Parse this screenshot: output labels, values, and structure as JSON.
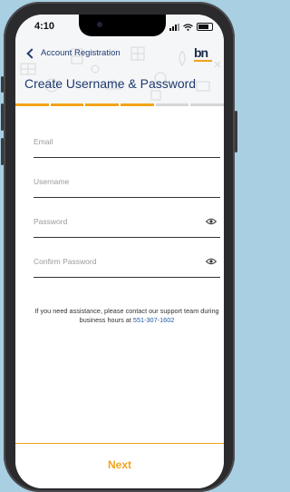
{
  "status_bar": {
    "time": "4:10"
  },
  "header": {
    "back_label": "Account Registration",
    "logo_text": "bn",
    "title": "Create Username & Password"
  },
  "progress": {
    "total_steps": 6,
    "completed_steps": 4,
    "active_color": "#f2a31b",
    "inactive_color": "#d6d6d6"
  },
  "form": {
    "email": {
      "placeholder": "Email",
      "value": ""
    },
    "username": {
      "placeholder": "Username",
      "value": ""
    },
    "password": {
      "placeholder": "Password",
      "value": ""
    },
    "confirm_password": {
      "placeholder": "Confirm Password",
      "value": ""
    }
  },
  "help": {
    "text": "If you need assistance, please contact our support team during business hours at ",
    "phone": "551-307-1602"
  },
  "footer": {
    "next_label": "Next"
  },
  "colors": {
    "brand_blue": "#1f3a6e",
    "accent_orange": "#f2a31b",
    "link_blue": "#1f5aa6"
  }
}
